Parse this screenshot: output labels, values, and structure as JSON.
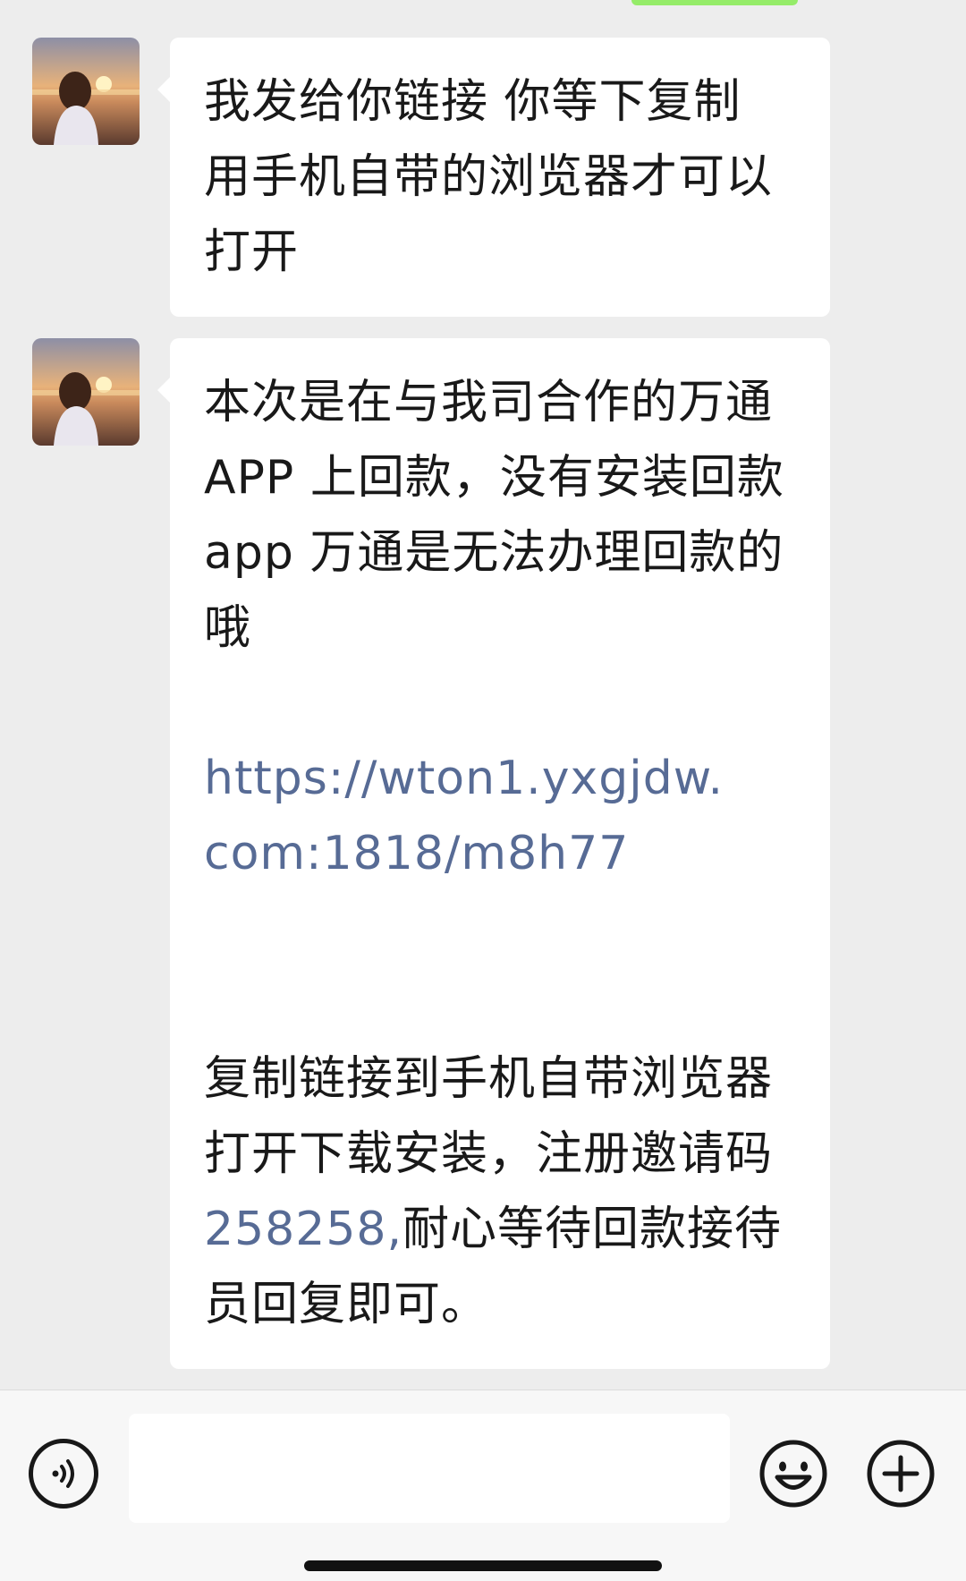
{
  "chat": {
    "messages": [
      {
        "sender": "contact",
        "avatar_icon": "avatar-sunset-photo",
        "lines": [
          "我发给你链接 你等下复制",
          "用手机自带的浏览器才可以",
          "打开"
        ]
      },
      {
        "sender": "contact",
        "avatar_icon": "avatar-sunset-photo",
        "paragraph1": [
          "本次是在与我司合作的万通",
          "APP 上回款，没有安装回款",
          "app 万通是无法办理回款的",
          "哦"
        ],
        "link_line1": "https://wton1.yxgjdw.",
        "link_line2": "com:1818/m8h77",
        "paragraph2": [
          "复制链接到手机自带浏览器",
          "打开下载安装，注册邀请码"
        ],
        "invite_code": "258258,",
        "after_code": "耐心等待回款接待",
        "last_line": "员回复即可。"
      }
    ]
  },
  "input_bar": {
    "voice_icon": "voice-icon",
    "text_value": "",
    "emoji_icon": "emoji-icon",
    "plus_icon": "plus-icon"
  },
  "colors": {
    "background": "#ededed",
    "bubble": "#ffffff",
    "link": "#576b95",
    "sent_bubble": "#95ec69"
  }
}
